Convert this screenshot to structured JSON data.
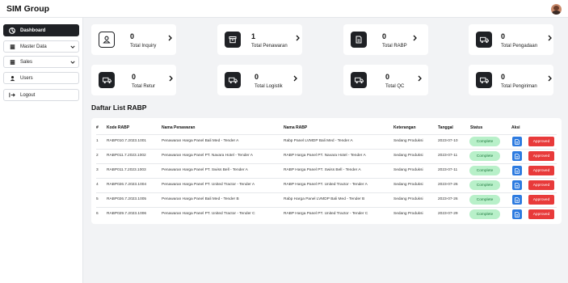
{
  "app": {
    "title": "SIM Group"
  },
  "sidebar": {
    "items": [
      {
        "label": "Dashboard",
        "icon": "dashboard-icon",
        "active": true
      },
      {
        "label": "Master Data",
        "icon": "database-icon",
        "chevron": true
      },
      {
        "label": "Sales",
        "icon": "database-icon",
        "chevron": true
      },
      {
        "label": "Users",
        "icon": "user-icon"
      },
      {
        "label": "Logout",
        "icon": "logout-icon"
      }
    ]
  },
  "stats": [
    {
      "value": "0",
      "label": "Total Inquiry",
      "icon": "user-icon"
    },
    {
      "value": "1",
      "label": "Total Penawaran",
      "icon": "archive-icon"
    },
    {
      "value": "0",
      "label": "Total RABP",
      "icon": "document-icon"
    },
    {
      "value": "0",
      "label": "Total Pengadaan",
      "icon": "truck-icon"
    },
    {
      "value": "0",
      "label": "Total Retur",
      "icon": "truck-icon"
    },
    {
      "value": "0",
      "label": "Total Logistik",
      "icon": "truck-icon"
    },
    {
      "value": "0",
      "label": "Total QC",
      "icon": "truck-icon"
    },
    {
      "value": "0",
      "label": "Total Pengiriman",
      "icon": "truck-icon"
    }
  ],
  "section": {
    "title": "Daftar List RABP"
  },
  "table": {
    "headers": [
      "#",
      "Kode RABP",
      "Nama Penawaran",
      "Nama RABP",
      "Keterangan",
      "Tanggal",
      "Status",
      "Aksi"
    ],
    "rows": [
      {
        "no": "1",
        "kode": "RABP010.7.2023.1001",
        "penawaran": "Penawaran Harga Panel Bali Med - Tender A",
        "rabp": "Rabp Panel LVMDP Bali Med - Tender A",
        "ket": "Sedang Produksi",
        "tgl": "2023-07-10",
        "status": "Complete",
        "aksi": "Approved"
      },
      {
        "no": "2",
        "kode": "RABP011.7.2023.1002",
        "penawaran": "Penawaran Harga Panel PT. Navara Hotel - Tender A",
        "rabp": "RABP Harga Panel PT. Navara Hotel - Tender A",
        "ket": "Sedang Produksi",
        "tgl": "2023-07-11",
        "status": "Complete",
        "aksi": "Approved"
      },
      {
        "no": "3",
        "kode": "RABP011.7.2023.1003",
        "penawaran": "Penawaran Harga Panel PT. Swiss Bell - Tender A",
        "rabp": "RABP Harga Panel PT. Swiss Bell - Tender A",
        "ket": "Sedang Produksi",
        "tgl": "2023-07-11",
        "status": "Complete",
        "aksi": "Approved"
      },
      {
        "no": "4",
        "kode": "RABP026.7.2023.1004",
        "penawaran": "Penawaran Harga Panel PT. United Tractor - Tender A",
        "rabp": "RABP Harga Panel PT. United Tractor - Tender A",
        "ket": "Sedang Produksi",
        "tgl": "2023-07-26",
        "status": "Complete",
        "aksi": "Approved"
      },
      {
        "no": "5",
        "kode": "RABP026.7.2023.1005",
        "penawaran": "Penawaran Harga Panel Bali Med - Tender B",
        "rabp": "Rabp Harga Panel LVMDP Bali Med - Tender B",
        "ket": "Sedang Produksi",
        "tgl": "2023-07-26",
        "status": "Complete",
        "aksi": "Approved"
      },
      {
        "no": "6",
        "kode": "RABP029.7.2023.1006",
        "penawaran": "Penawaran Harga Panel PT. United Tractor - Tender C",
        "rabp": "RABP Harga Panel PT. United Tractor - Tender C",
        "ket": "Sedang Produksi",
        "tgl": "2023-07-29",
        "status": "Complete",
        "aksi": "Approved"
      }
    ]
  },
  "colors": {
    "dark": "#1f2125",
    "complete_bg": "#b8f0c9",
    "complete_text": "#1f7a3e",
    "approved": "#e83a3a",
    "doc_button": "#2d7be0"
  }
}
